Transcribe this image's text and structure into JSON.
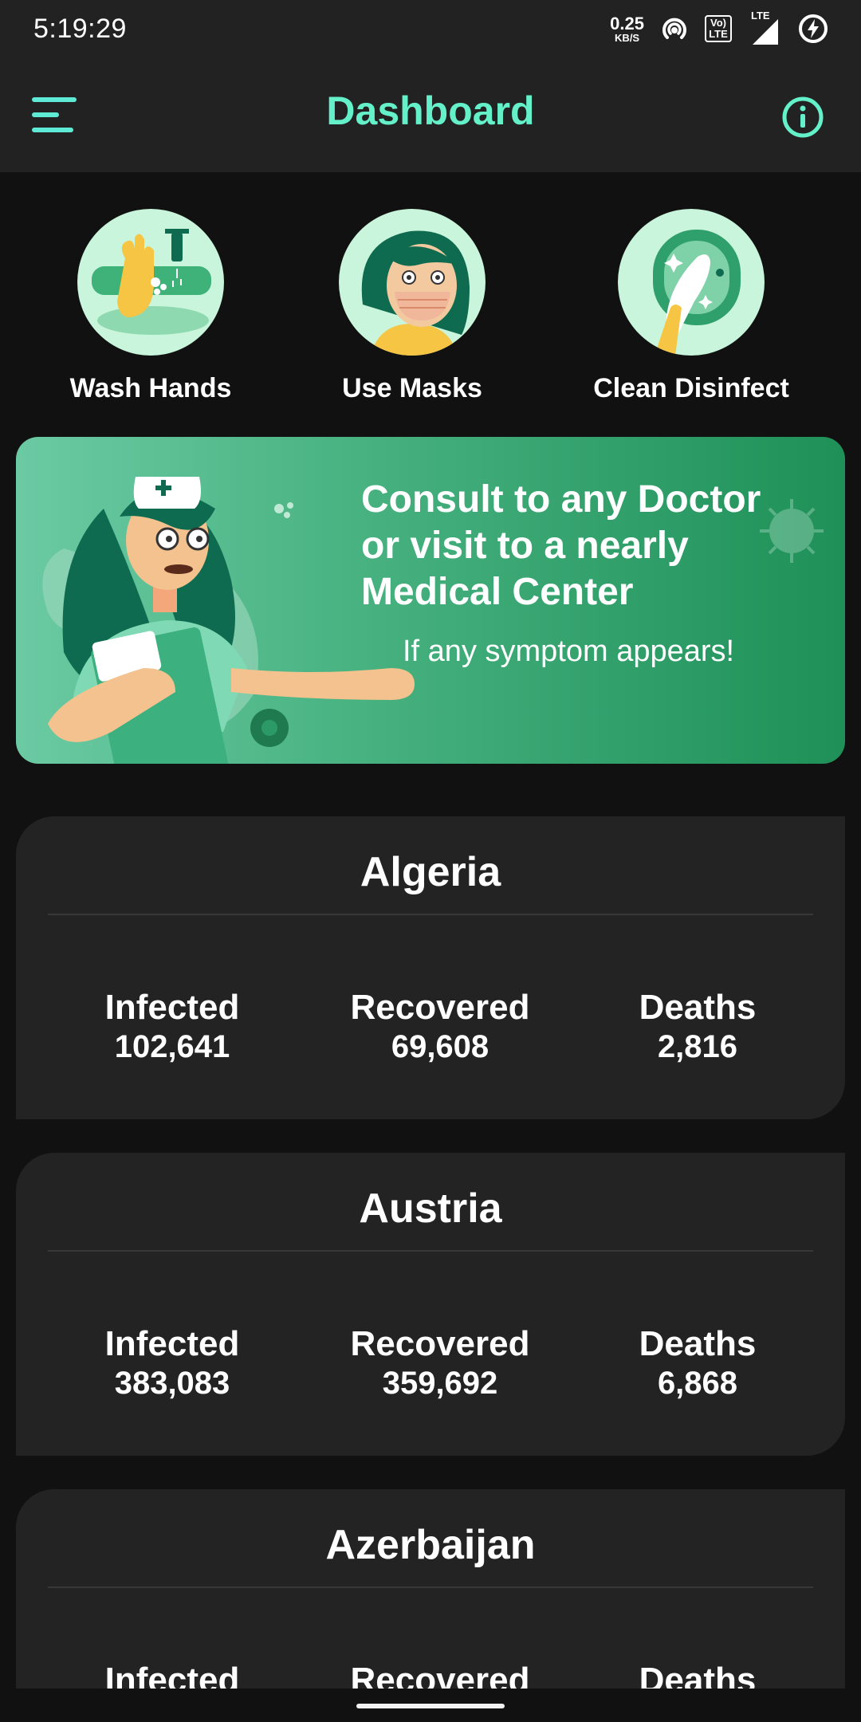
{
  "status_bar": {
    "time": "5:19:29",
    "net_speed_value": "0.25",
    "net_speed_unit": "KB/S",
    "volte_top": "Vo)",
    "volte_bottom": "LTE",
    "lte_label": "LTE",
    "icons": [
      "hotspot-icon",
      "volte-icon",
      "signal-icon",
      "battery-saver-icon"
    ]
  },
  "app_bar": {
    "title": "Dashboard",
    "accent_color": "#64f0c8",
    "left_icon": "menu-icon",
    "right_icon": "info-icon"
  },
  "tips": [
    {
      "label": "Wash Hands",
      "icon": "wash-hands-illustration"
    },
    {
      "label": "Use Masks",
      "icon": "mask-illustration"
    },
    {
      "label": "Clean Disinfect",
      "icon": "clean-disinfect-illustration"
    }
  ],
  "banner": {
    "title_lines": [
      "Consult to any Doctor",
      "or visit to a nearly",
      "Medical Center"
    ],
    "subtitle": "If any symptom appears!",
    "illustration": "doctor-illustration"
  },
  "countries": [
    {
      "name": "Algeria",
      "stats": [
        {
          "label": "Infected",
          "value": "102,641"
        },
        {
          "label": "Recovered",
          "value": "69,608"
        },
        {
          "label": "Deaths",
          "value": "2,816"
        }
      ]
    },
    {
      "name": "Austria",
      "stats": [
        {
          "label": "Infected",
          "value": "383,083"
        },
        {
          "label": "Recovered",
          "value": "359,692"
        },
        {
          "label": "Deaths",
          "value": "6,868"
        }
      ]
    },
    {
      "name": "Azerbaijan",
      "stats": [
        {
          "label": "Infected",
          "value": ""
        },
        {
          "label": "Recovered",
          "value": ""
        },
        {
          "label": "Deaths",
          "value": ""
        }
      ]
    }
  ]
}
